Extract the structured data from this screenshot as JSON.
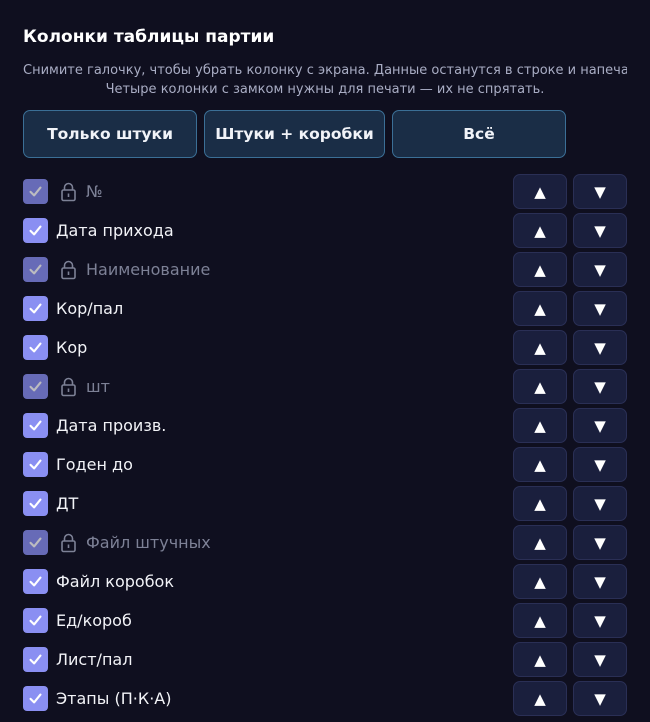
{
  "title": "Колонки таблицы партии",
  "hint_line1": "Снимите галочку, чтобы убрать колонку с экрана. Данные останутся в строке и напечатаются.",
  "hint_line2": "Четыре колонки с замком нужны для печати — их не спрятать.",
  "presets": [
    {
      "label": "Только штуки"
    },
    {
      "label": "Штуки + коробки"
    },
    {
      "label": "Всё"
    }
  ],
  "icons": {
    "checkbox": "checkmark-icon",
    "lock": "lock-icon",
    "up": "arrow-up-icon",
    "down": "arrow-down-icon"
  },
  "colors": {
    "background": "#0f0f1f",
    "checkbox": "#8a8ff2",
    "preset_border": "#3b6f96",
    "preset_bg": "#1a2d46",
    "arrow_bg": "#1a1f3d"
  },
  "up_label": "▲",
  "down_label": "▼",
  "columns": [
    {
      "label": "№",
      "locked": true,
      "checked": true
    },
    {
      "label": "Дата прихода",
      "locked": false,
      "checked": true
    },
    {
      "label": "Наименование",
      "locked": true,
      "checked": true
    },
    {
      "label": "Кор/пал",
      "locked": false,
      "checked": true
    },
    {
      "label": "Кор",
      "locked": false,
      "checked": true
    },
    {
      "label": "шт",
      "locked": true,
      "checked": true
    },
    {
      "label": "Дата произв.",
      "locked": false,
      "checked": true
    },
    {
      "label": "Годен до",
      "locked": false,
      "checked": true
    },
    {
      "label": "ДТ",
      "locked": false,
      "checked": true
    },
    {
      "label": "Файл штучных",
      "locked": true,
      "checked": true
    },
    {
      "label": "Файл коробок",
      "locked": false,
      "checked": true
    },
    {
      "label": "Ед/короб",
      "locked": false,
      "checked": true
    },
    {
      "label": "Лист/пал",
      "locked": false,
      "checked": true
    },
    {
      "label": "Этапы (П·К·А)",
      "locked": false,
      "checked": true
    }
  ]
}
